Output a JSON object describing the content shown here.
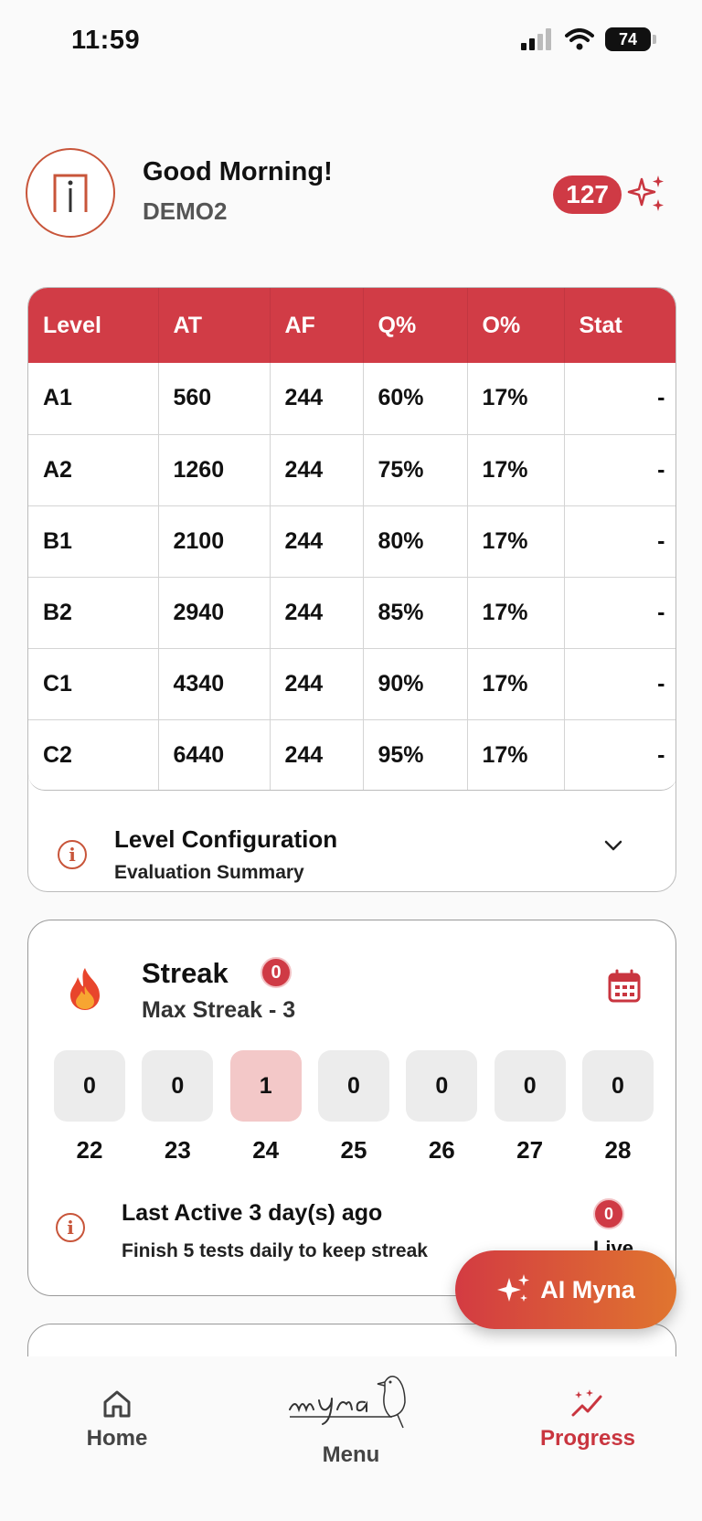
{
  "status": {
    "time": "11:59",
    "battery": "74"
  },
  "header": {
    "greeting": "Good Morning!",
    "username": "DEMO2",
    "points": "127"
  },
  "levels_table": {
    "columns": [
      "Level",
      "AT",
      "AF",
      "Q%",
      "O%",
      "Stat"
    ],
    "rows": [
      [
        "A1",
        "560",
        "244",
        "60%",
        "17%",
        "-"
      ],
      [
        "A2",
        "1260",
        "244",
        "75%",
        "17%",
        "-"
      ],
      [
        "B1",
        "2100",
        "244",
        "80%",
        "17%",
        "-"
      ],
      [
        "B2",
        "2940",
        "244",
        "85%",
        "17%",
        "-"
      ],
      [
        "C1",
        "4340",
        "244",
        "90%",
        "17%",
        "-"
      ],
      [
        "C2",
        "6440",
        "244",
        "95%",
        "17%",
        "-"
      ]
    ]
  },
  "level_config": {
    "title": "Level Configuration",
    "subtitle": "Evaluation Summary"
  },
  "streak": {
    "title": "Streak",
    "count": "0",
    "max_streak": "Max Streak - 3",
    "days": [
      {
        "value": "0",
        "date": "22"
      },
      {
        "value": "0",
        "date": "23"
      },
      {
        "value": "1",
        "date": "24"
      },
      {
        "value": "0",
        "date": "25"
      },
      {
        "value": "0",
        "date": "26"
      },
      {
        "value": "0",
        "date": "27"
      },
      {
        "value": "0",
        "date": "28"
      }
    ],
    "last_active": "Last Active 3 day(s) ago",
    "hint": "Finish 5 tests daily to keep streak",
    "live_count": "0",
    "live_label": "Live"
  },
  "ai_button": {
    "label": "AI Myna"
  },
  "nav": {
    "home": "Home",
    "menu": "Menu",
    "progress": "Progress"
  },
  "colors": {
    "accent": "#d13c46",
    "active_day": "#f3c8c8"
  }
}
